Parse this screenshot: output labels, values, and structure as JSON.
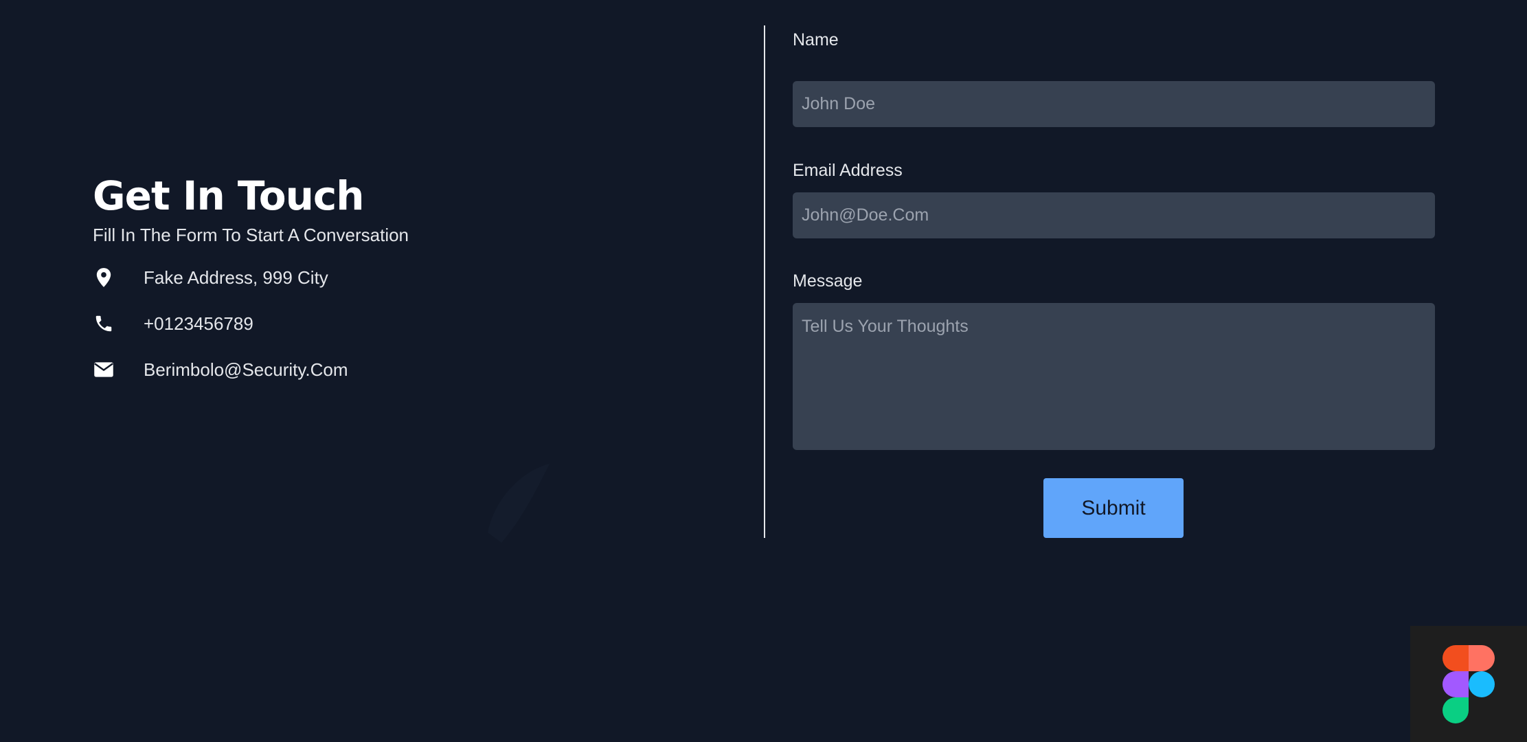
{
  "contact": {
    "title": "Get In Touch",
    "subtitle": "Fill In The Form To Start A Conversation",
    "items": [
      {
        "icon": "location-pin-icon",
        "text": "Fake Address, 999 City"
      },
      {
        "icon": "phone-icon",
        "text": "+0123456789"
      },
      {
        "icon": "mail-icon",
        "text": "Berimbolo@Security.Com"
      }
    ]
  },
  "form": {
    "name": {
      "label": "Name",
      "placeholder": "John Doe",
      "value": ""
    },
    "email": {
      "label": "Email Address",
      "placeholder": "John@Doe.Com",
      "value": ""
    },
    "message": {
      "label": "Message",
      "placeholder": "Tell Us Your Thoughts",
      "value": ""
    },
    "submit_label": "Submit"
  },
  "colors": {
    "background": "#111827",
    "input_background": "#374151",
    "accent": "#60a5fa",
    "text": "#e5e7eb"
  },
  "badge": {
    "icon": "figma-logo-icon"
  }
}
